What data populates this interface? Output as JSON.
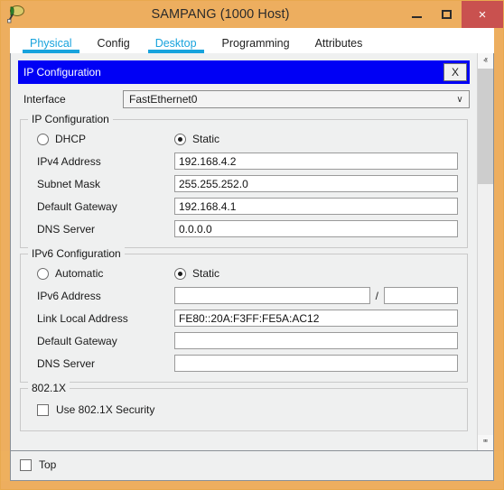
{
  "window": {
    "title": "SAMPANG (1000 Host)",
    "icon": "packet-tracer-icon",
    "minimize_label": "–",
    "maximize_label": "□",
    "close_label": "×",
    "frame_color": "#edae5f",
    "close_button_color": "#c9514f"
  },
  "tabs": [
    {
      "label": "Physical",
      "active": true
    },
    {
      "label": "Config",
      "active": false
    },
    {
      "label": "Desktop",
      "active": true
    },
    {
      "label": "Programming",
      "active": false
    },
    {
      "label": "Attributes",
      "active": false
    }
  ],
  "dialog": {
    "title": "IP Configuration",
    "close_label": "X",
    "title_bar_color": "#0000f5"
  },
  "interface": {
    "label": "Interface",
    "value": "FastEthernet0",
    "chevron": "∨"
  },
  "ipv4": {
    "legend": "IP Configuration",
    "mode_options": [
      {
        "label": "DHCP",
        "selected": false
      },
      {
        "label": "Static",
        "selected": true
      }
    ],
    "fields": [
      {
        "label": "IPv4 Address",
        "value": "192.168.4.2"
      },
      {
        "label": "Subnet Mask",
        "value": "255.255.252.0"
      },
      {
        "label": "Default Gateway",
        "value": "192.168.4.1"
      },
      {
        "label": "DNS Server",
        "value": "0.0.0.0"
      }
    ]
  },
  "ipv6": {
    "legend": "IPv6 Configuration",
    "mode_options": [
      {
        "label": "Automatic",
        "selected": false
      },
      {
        "label": "Static",
        "selected": true
      }
    ],
    "address_label": "IPv6 Address",
    "address_value": "",
    "prefix_separator": "/",
    "prefix_value": "",
    "fields": [
      {
        "label": "Link Local Address",
        "value": "FE80::20A:F3FF:FE5A:AC12"
      },
      {
        "label": "Default Gateway",
        "value": ""
      },
      {
        "label": "DNS Server",
        "value": ""
      }
    ]
  },
  "dot1x": {
    "legend": "802.1X",
    "checkbox_label": "Use 802.1X Security",
    "checked": false
  },
  "footer": {
    "top_label": "Top",
    "top_checked": false
  },
  "scrollbar": {
    "up_arrow": "ⱏ",
    "down_arrow": "ⱎ"
  }
}
